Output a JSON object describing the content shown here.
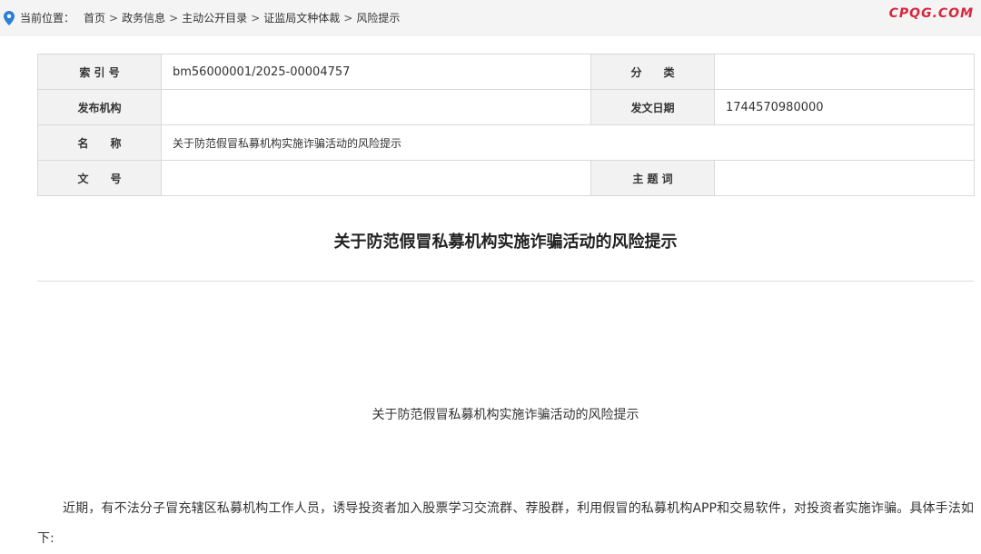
{
  "breadcrumb": {
    "label": "当前位置：",
    "items": [
      "首页",
      "政务信息",
      "主动公开目录",
      "证监局文种体裁",
      "风险提示"
    ],
    "separator": ">"
  },
  "logo": {
    "text": "CPQG.COM",
    "color": "#d7263d"
  },
  "icons": {
    "location": "location-pin-icon"
  },
  "meta": {
    "index_label": "索 引 号",
    "index_value": "bm56000001/2025-00004757",
    "category_label": "分　　类",
    "category_value": "",
    "publisher_label": "发布机构",
    "publisher_value": "",
    "date_label": "发文日期",
    "date_value": "1744570980000",
    "name_label": "名　　称",
    "name_value": "关于防范假冒私募机构实施诈骗活动的风险提示",
    "docno_label": "文　　号",
    "docno_value": "",
    "keywords_label": "主 题 词",
    "keywords_value": ""
  },
  "article": {
    "title": "关于防范假冒私募机构实施诈骗活动的风险提示",
    "subtitle": "关于防范假冒私募机构实施诈骗活动的风险提示",
    "paragraph1": "近期，有不法分子冒充辖区私募机构工作人员，诱导投资者加入股票学习交流群、荐股群，利用假冒的私募机构APP和交易软件，对投资者实施诈骗。具体手法如下:"
  },
  "colors": {
    "accent": "#2b7fd6",
    "table_header_bg": "#f2f2f2",
    "border": "#d9d9d9"
  }
}
